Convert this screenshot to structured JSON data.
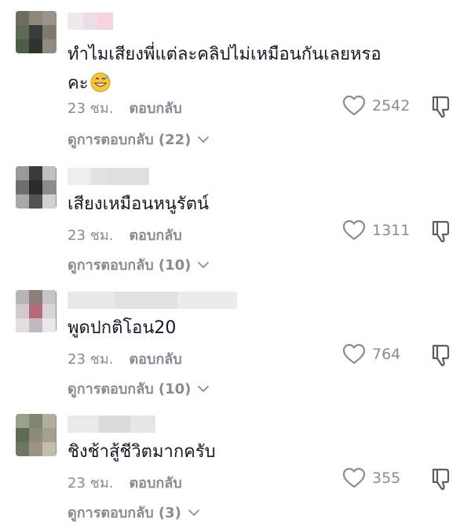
{
  "comments": [
    {
      "text_line1": "ทำไมเสียงพี่แต่ละคลิปไม่เหมือนกันเลยหรอ",
      "text_line2": "คะ",
      "emoji": "grinning-sweat-emoji",
      "time": "23 ชม.",
      "reply_label": "ตอบกลับ",
      "likes": "2542",
      "view_replies": "ดูการตอบกลับ (22)"
    },
    {
      "text_line1": "เสียงเหมือนหนูรัตน์",
      "time": "23 ชม.",
      "reply_label": "ตอบกลับ",
      "likes": "1311",
      "view_replies": "ดูการตอบกลับ (10)"
    },
    {
      "text_line1": "พูดปกติโอน20",
      "time": "23 ชม.",
      "reply_label": "ตอบกลับ",
      "likes": "764",
      "view_replies": "ดูการตอบกลับ (10)"
    },
    {
      "text_line1": "ชิงช้าสู้ชีวิตมากครับ",
      "time": "23 ชม.",
      "reply_label": "ตอบกลับ",
      "likes": "355",
      "view_replies": "ดูการตอบกลับ (3)"
    }
  ],
  "colors": {
    "text": "#161823",
    "muted": "#8a8b91",
    "background": "#ffffff"
  },
  "icons": [
    "heart-icon",
    "thumbs-down-icon",
    "chevron-down-icon",
    "avatar-pixelated"
  ]
}
